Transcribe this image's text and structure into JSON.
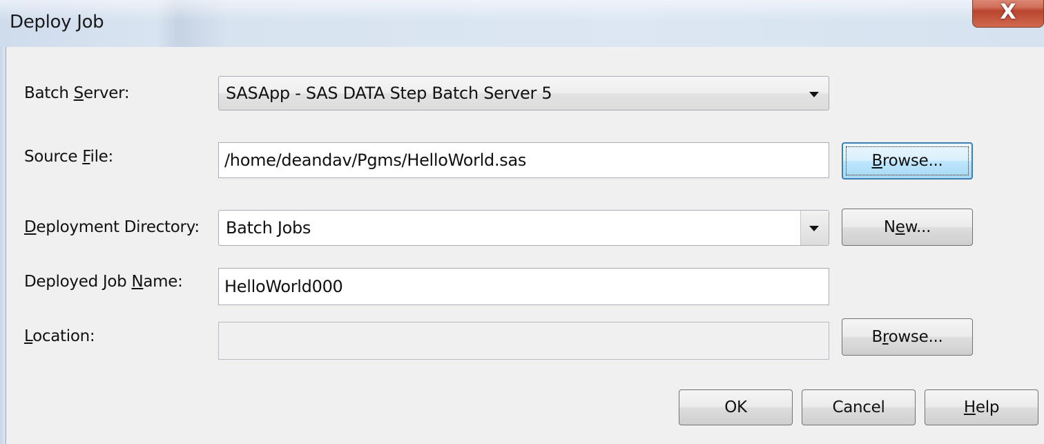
{
  "window": {
    "title": "Deploy Job",
    "close_glyph": "X"
  },
  "form": {
    "batch_server": {
      "label_pre": "Batch ",
      "label_mnemonic": "S",
      "label_post": "erver:",
      "value": "SASApp - SAS DATA Step Batch Server 5"
    },
    "source_file": {
      "label_pre": "Source ",
      "label_mnemonic": "F",
      "label_post": "ile:",
      "value": "/home/deandav/Pgms/HelloWorld.sas",
      "browse_mnemonic": "B",
      "browse_rest": "rowse..."
    },
    "deployment_directory": {
      "label_mnemonic": "D",
      "label_post": "eployment Directory:",
      "value": "Batch Jobs",
      "new_pre": "N",
      "new_mnemonic": "e",
      "new_post": "w..."
    },
    "deployed_job_name": {
      "label_pre": "Deployed Job ",
      "label_mnemonic": "N",
      "label_post": "ame:",
      "value": "HelloWorld000"
    },
    "location": {
      "label_mnemonic": "L",
      "label_post": "ocation:",
      "value": "",
      "browse_pre": "B",
      "browse_mnemonic": "r",
      "browse_post": "owse..."
    }
  },
  "buttons": {
    "ok": "OK",
    "cancel": "Cancel",
    "help_mnemonic": "H",
    "help_post": "elp"
  }
}
